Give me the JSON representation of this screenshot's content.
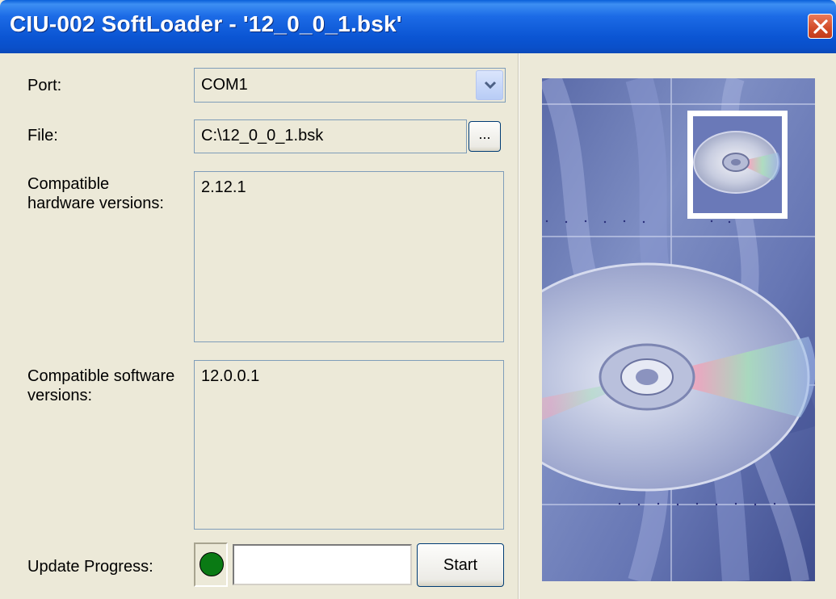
{
  "window": {
    "title": "CIU-002 SoftLoader - '12_0_0_1.bsk'"
  },
  "form": {
    "port_label": "Port:",
    "port_value": "COM1",
    "file_label": "File:",
    "file_value": "C:\\12_0_0_1.bsk",
    "browse_label": "...",
    "hw_label_line1": "Compatible",
    "hw_label_line2": "hardware versions:",
    "hw_versions": "2.12.1",
    "sw_label_line1": "Compatible software",
    "sw_label_line2": "versions:",
    "sw_versions": "12.0.0.1",
    "progress_label": "Update Progress:",
    "start_label": "Start"
  },
  "colors": {
    "titlebar": "#0b55d3",
    "status_led": "#0a7a14",
    "panel_bg": "#ece9d8"
  },
  "icons": {
    "close": "close-icon",
    "dropdown": "chevron-down-icon",
    "status": "status-led-icon",
    "cd": "cd-disc-icon"
  }
}
